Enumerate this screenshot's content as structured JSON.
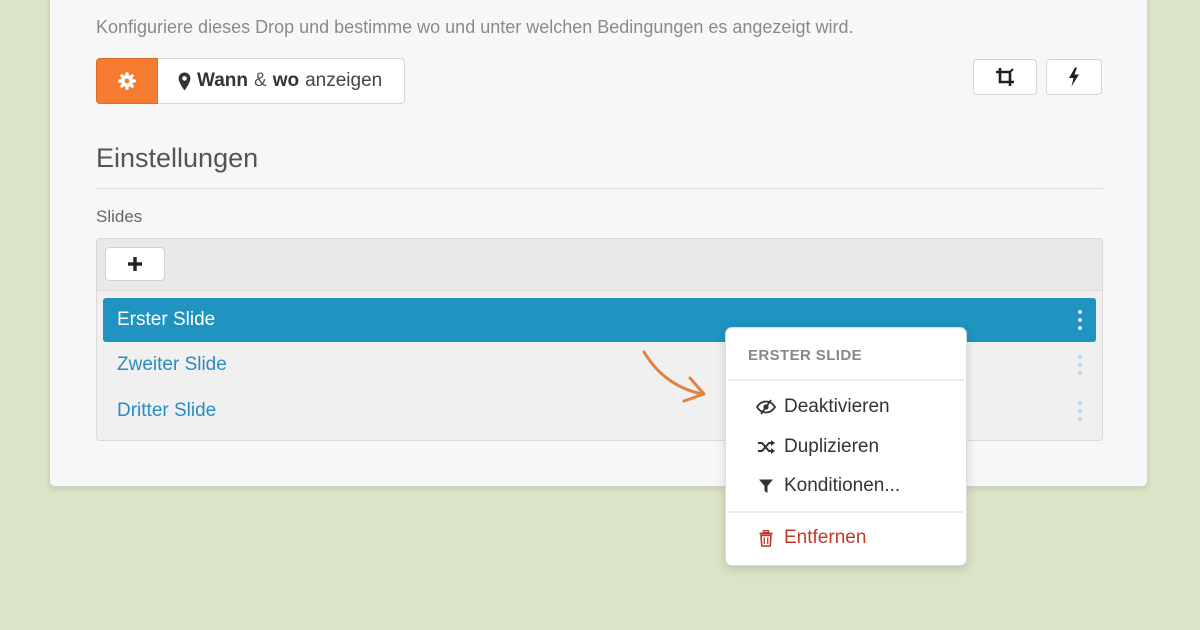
{
  "panel": {
    "description": "Konfiguriere dieses Drop und bestimme wo und unter welchen Bedingungen es angezeigt wird.",
    "tabs": {
      "gear_icon": "gear-icon",
      "where_icon": "map-marker-icon",
      "where_bold1": "Wann",
      "where_amp": "&",
      "where_bold2": "wo",
      "where_rest": "anzeigen"
    },
    "toolbar_icons": [
      "crop-icon",
      "bolt-icon"
    ],
    "section_title": "Einstellungen",
    "slides_label": "Slides",
    "add_icon": "plus-icon",
    "slides": [
      {
        "label": "Erster Slide",
        "active": true
      },
      {
        "label": "Zweiter Slide",
        "active": false
      },
      {
        "label": "Dritter Slide",
        "active": false
      }
    ]
  },
  "context_menu": {
    "header": "ERSTER SLIDE",
    "items": [
      {
        "label": "Deaktivieren",
        "icon": "eye-slash-icon"
      },
      {
        "label": "Duplizieren",
        "icon": "shuffle-icon"
      },
      {
        "label": "Konditionen...",
        "icon": "filter-icon"
      }
    ],
    "danger_item": {
      "label": "Entfernen",
      "icon": "trash-icon"
    }
  },
  "colors": {
    "background": "#dbe4c7",
    "accent_orange": "#f47b2f",
    "active_blue": "#1f93c1",
    "link_blue": "#2a8cc0",
    "danger_red": "#c0392b"
  }
}
